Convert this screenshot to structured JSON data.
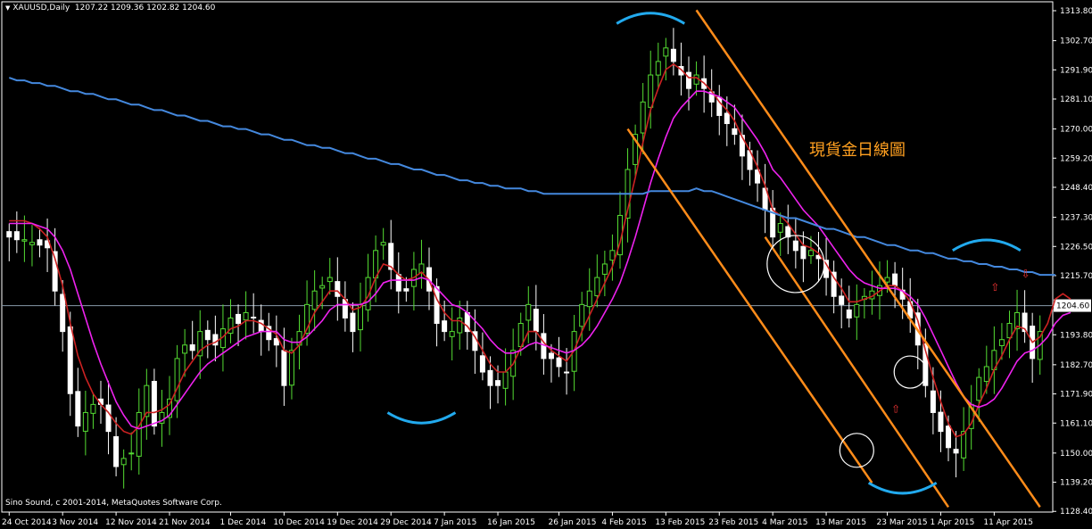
{
  "header": {
    "symbol": "XAUUSD,Daily",
    "ohlc": "1207.22 1209.36 1202.82 1204.60"
  },
  "copyright": "Sino Sound, c 2001-2014, MetaQuotes Software Corp.",
  "annotation": "現貨金日線圖",
  "colors": {
    "background": "#000000",
    "axis": "#ffffff",
    "bull_candle": "#55dd33",
    "bear_candle": "#ffffff",
    "ma_fast": "#cc2222",
    "ma_mid": "#ee22ee",
    "ma_slow": "#4488dd",
    "channel": "#ff8c1a",
    "swing_arc": "#22aaee",
    "circle": "#ffffff",
    "arrow": "#ee3333",
    "price_line": "#8899aa"
  },
  "chart_data": {
    "type": "candlestick",
    "current_price": 1204.6,
    "ylim": [
      1128.81,
      1313.8
    ],
    "y_ticks": [
      1313.8,
      1302.7,
      1291.9,
      1281.1,
      1270.0,
      1259.2,
      1248.4,
      1237.3,
      1226.5,
      1215.7,
      1204.6,
      1193.8,
      1182.7,
      1171.9,
      1161.1,
      1150.0,
      1139.2,
      1128.4
    ],
    "y_tick_labels": [
      "1313.80",
      "1302.70",
      "1291.90",
      "1281.10",
      "1270.00",
      "1259.20",
      "1248.40",
      "1237.30",
      "1226.50",
      "1215.70",
      "1204.60",
      "1193.80",
      "1182.70",
      "1171.90",
      "1161.10",
      "1150.00",
      "1139.20",
      "1128.40"
    ],
    "x_labels": [
      "24 Oct 2014",
      "3 Nov 2014",
      "12 Nov 2014",
      "21 Nov 2014",
      "1 Dec 2014",
      "10 Dec 2014",
      "19 Dec 2014",
      "29 Dec 2014",
      "7 Jan 2015",
      "16 Jan 2015",
      "26 Jan 2015",
      "4 Feb 2015",
      "13 Feb 2015",
      "23 Feb 2015",
      "4 Mar 2015",
      "13 Mar 2015",
      "23 Mar 2015",
      "1 Apr 2015",
      "11 Apr 2015"
    ],
    "bar_count": 136,
    "close": [
      1230,
      1229,
      1229,
      1228,
      1227,
      1226,
      1210,
      1195,
      1172,
      1160,
      1165,
      1168,
      1168,
      1158,
      1145,
      1148,
      1150,
      1165,
      1175,
      1160,
      1165,
      1170,
      1185,
      1190,
      1188,
      1195,
      1192,
      1190,
      1196,
      1200,
      1198,
      1202,
      1200,
      1195,
      1192,
      1190,
      1175,
      1188,
      1195,
      1205,
      1210,
      1212,
      1215,
      1208,
      1200,
      1195,
      1205,
      1215,
      1225,
      1228,
      1218,
      1210,
      1210,
      1218,
      1220,
      1210,
      1198,
      1195,
      1195,
      1200,
      1195,
      1188,
      1180,
      1175,
      1175,
      1180,
      1188,
      1198,
      1205,
      1195,
      1185,
      1185,
      1182,
      1180,
      1195,
      1205,
      1210,
      1215,
      1220,
      1225,
      1238,
      1255,
      1268,
      1280,
      1290,
      1295,
      1300,
      1295,
      1290,
      1285,
      1290,
      1285,
      1280,
      1275,
      1272,
      1268,
      1260,
      1255,
      1250,
      1240,
      1230,
      1235,
      1230,
      1225,
      1222,
      1225,
      1222,
      1215,
      1208,
      1205,
      1200,
      1205,
      1208,
      1210,
      1212,
      1215,
      1212,
      1207,
      1200,
      1190,
      1175,
      1165,
      1158,
      1152,
      1150,
      1158,
      1168,
      1178,
      1182,
      1188,
      1192,
      1198,
      1202,
      1195,
      1185,
      1195,
      1205,
      1218,
      1212,
      1204.6
    ],
    "series": [
      {
        "name": "",
        "values": [
          1236,
          1236,
          1236,
          1235,
          1233,
          1230,
          1222,
          1212,
          1198,
          1186,
          1178,
          1172,
          1168,
          1165,
          1161,
          1158,
          1157,
          1160,
          1165,
          1165,
          1166,
          1168,
          1174,
          1180,
          1184,
          1188,
          1190,
          1191,
          1193,
          1196,
          1197,
          1199,
          1199,
          1198,
          1196,
          1194,
          1188,
          1187,
          1190,
          1196,
          1202,
          1206,
          1210,
          1210,
          1207,
          1203,
          1204,
          1208,
          1215,
          1220,
          1219,
          1216,
          1214,
          1215,
          1217,
          1214,
          1207,
          1202,
          1199,
          1199,
          1197,
          1193,
          1188,
          1183,
          1180,
          1180,
          1183,
          1189,
          1195,
          1195,
          1191,
          1188,
          1186,
          1184,
          1188,
          1195,
          1201,
          1207,
          1213,
          1219,
          1228,
          1240,
          1252,
          1265,
          1277,
          1285,
          1292,
          1294,
          1292,
          1289,
          1289,
          1287,
          1284,
          1280,
          1277,
          1273,
          1267,
          1262,
          1256,
          1249,
          1240,
          1238,
          1235,
          1231,
          1227,
          1226,
          1224,
          1220,
          1215,
          1211,
          1206,
          1206,
          1207,
          1208,
          1210,
          1212,
          1212,
          1210,
          1206,
          1199,
          1188,
          1178,
          1169,
          1161,
          1156,
          1157,
          1161,
          1168,
          1174,
          1181,
          1186,
          1192,
          1197,
          1196,
          1191,
          1193,
          1198,
          1207,
          1209,
          1207
        ]
      },
      {
        "name": "",
        "values": [
          1235,
          1235,
          1235,
          1235,
          1234,
          1233,
          1230,
          1225,
          1218,
          1209,
          1200,
          1191,
          1183,
          1176,
          1169,
          1164,
          1160,
          1159,
          1160,
          1161,
          1162,
          1164,
          1168,
          1172,
          1176,
          1180,
          1183,
          1185,
          1187,
          1189,
          1191,
          1193,
          1194,
          1195,
          1195,
          1195,
          1192,
          1191,
          1191,
          1193,
          1196,
          1199,
          1203,
          1205,
          1205,
          1205,
          1205,
          1206,
          1209,
          1213,
          1214,
          1214,
          1214,
          1214,
          1215,
          1214,
          1211,
          1208,
          1205,
          1204,
          1202,
          1199,
          1196,
          1192,
          1189,
          1187,
          1187,
          1188,
          1190,
          1191,
          1190,
          1189,
          1188,
          1187,
          1188,
          1190,
          1193,
          1197,
          1202,
          1207,
          1213,
          1221,
          1230,
          1240,
          1250,
          1259,
          1267,
          1274,
          1278,
          1281,
          1284,
          1284,
          1283,
          1282,
          1280,
          1278,
          1274,
          1270,
          1266,
          1261,
          1255,
          1252,
          1248,
          1244,
          1240,
          1237,
          1234,
          1230,
          1226,
          1222,
          1218,
          1215,
          1213,
          1212,
          1211,
          1211,
          1211,
          1210,
          1208,
          1205,
          1200,
          1194,
          1188,
          1182,
          1176,
          1171,
          1168,
          1167,
          1168,
          1170,
          1174,
          1179,
          1184,
          1187,
          1188,
          1190,
          1193,
          1198,
          1201,
          1202
        ]
      },
      {
        "name": "",
        "values": [
          1289,
          1288,
          1288,
          1287,
          1287,
          1286,
          1286,
          1285,
          1284,
          1284,
          1283,
          1283,
          1282,
          1281,
          1281,
          1280,
          1279,
          1279,
          1278,
          1277,
          1277,
          1276,
          1275,
          1275,
          1274,
          1273,
          1273,
          1272,
          1271,
          1271,
          1270,
          1270,
          1269,
          1268,
          1268,
          1267,
          1266,
          1266,
          1265,
          1264,
          1264,
          1263,
          1263,
          1262,
          1261,
          1261,
          1260,
          1259,
          1259,
          1258,
          1257,
          1257,
          1256,
          1255,
          1255,
          1254,
          1253,
          1253,
          1252,
          1251,
          1251,
          1250,
          1250,
          1249,
          1249,
          1248,
          1248,
          1248,
          1247,
          1247,
          1246,
          1246,
          1246,
          1246,
          1246,
          1246,
          1246,
          1246,
          1246,
          1246,
          1246,
          1246,
          1246,
          1246,
          1247,
          1247,
          1247,
          1247,
          1247,
          1247,
          1248,
          1247,
          1247,
          1246,
          1245,
          1244,
          1243,
          1242,
          1241,
          1240,
          1239,
          1238,
          1237,
          1237,
          1236,
          1235,
          1234,
          1233,
          1233,
          1232,
          1231,
          1230,
          1230,
          1229,
          1228,
          1227,
          1227,
          1226,
          1225,
          1225,
          1224,
          1224,
          1223,
          1222,
          1222,
          1221,
          1221,
          1220,
          1220,
          1219,
          1219,
          1218,
          1218,
          1217,
          1217,
          1216,
          1216,
          1216
        ]
      }
    ],
    "channel_lines": [
      [
        [
          90,
          1314
        ],
        [
          135,
          1130
        ]
      ],
      [
        [
          81,
          1270
        ],
        [
          113,
          1139
        ]
      ],
      [
        [
          123,
          1130
        ],
        [
          99,
          1230
        ]
      ]
    ]
  }
}
